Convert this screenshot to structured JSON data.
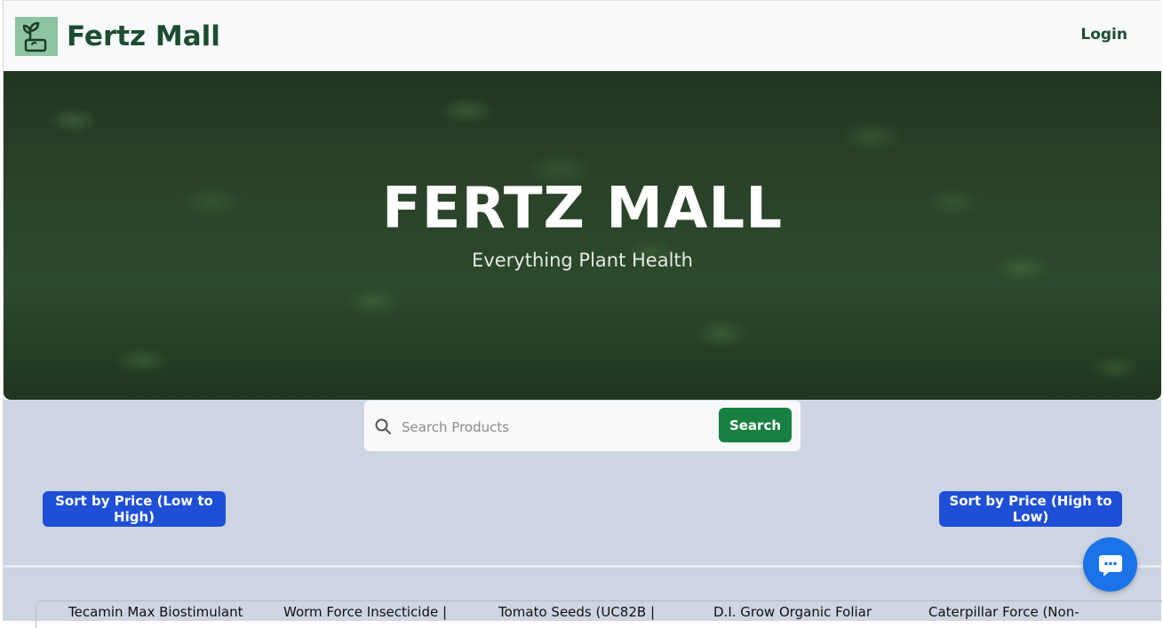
{
  "header": {
    "brand": "Fertz Mall",
    "login_label": "Login",
    "logo_icon": "seedling-pot-icon"
  },
  "hero": {
    "title": "FERTZ MALL",
    "subtitle": "Everything Plant Health"
  },
  "search": {
    "placeholder": "Search Products",
    "button_label": "Search"
  },
  "sort": {
    "low_to_high": "Sort by Price (Low to High)",
    "high_to_low": "Sort by Price (High to Low)"
  },
  "products": [
    {
      "name": "Tecamin Max Biostimulant"
    },
    {
      "name": "Worm Force Insecticide |"
    },
    {
      "name": "Tomato Seeds (UC82B |"
    },
    {
      "name": "D.I. Grow Organic Foliar"
    },
    {
      "name": "Caterpillar Force (Non-"
    }
  ],
  "colors": {
    "brand_green": "#1b4d32",
    "search_green": "#178040",
    "sort_blue": "#1e4fd6",
    "chat_blue": "#1a73e8",
    "section_bg": "#cdd5e2"
  },
  "chat": {
    "icon": "chat-bubble-icon"
  }
}
